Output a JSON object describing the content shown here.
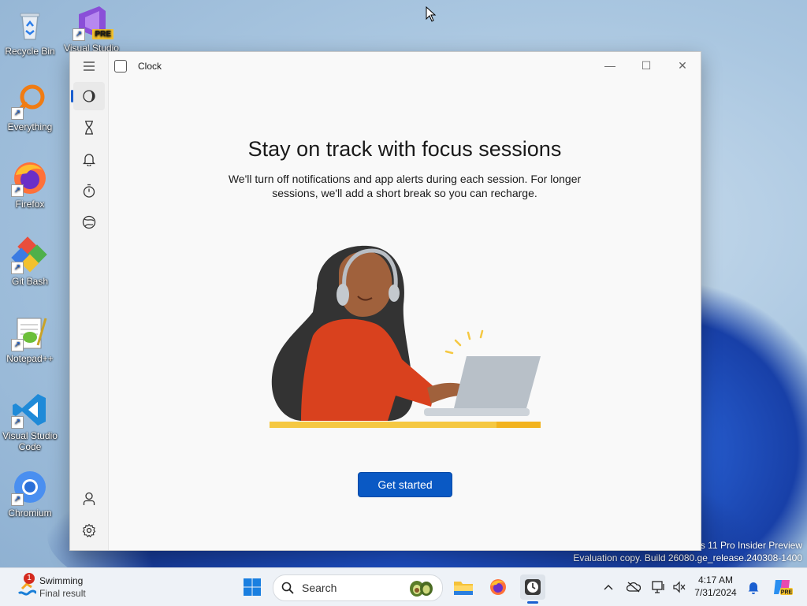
{
  "desktop": {
    "icons": [
      {
        "label": "Recycle Bin",
        "icon": "recycle-bin-icon"
      },
      {
        "label": "Visual Studio",
        "icon": "visual-studio-preview-icon",
        "badge": "PRE"
      },
      {
        "label": "Everything",
        "icon": "everything-search-icon"
      },
      {
        "label": "Firefox",
        "icon": "firefox-icon"
      },
      {
        "label": "Git Bash",
        "icon": "git-bash-icon"
      },
      {
        "label": "Notepad++",
        "icon": "notepad-plus-plus-icon"
      },
      {
        "label": "Visual Studio Code",
        "icon": "vscode-icon"
      },
      {
        "label": "Chromium",
        "icon": "chromium-icon"
      }
    ],
    "watermark": {
      "line1": "ws 11 Pro Insider Preview",
      "line2": "Evaluation copy. Build 26080.ge_release.240308-1400"
    }
  },
  "window": {
    "title": "Clock",
    "controls": {
      "minimize": "—",
      "maximize": "☐",
      "close": "✕"
    },
    "nav": [
      {
        "name": "menu",
        "icon": "hamburger-menu-icon"
      },
      {
        "name": "focus-sessions",
        "icon": "focus-sessions-icon",
        "selected": true
      },
      {
        "name": "timer",
        "icon": "hourglass-icon"
      },
      {
        "name": "alarm",
        "icon": "alarm-bell-icon"
      },
      {
        "name": "stopwatch",
        "icon": "stopwatch-icon"
      },
      {
        "name": "world-clock",
        "icon": "globe-icon"
      }
    ],
    "nav_bottom": [
      {
        "name": "account",
        "icon": "person-icon"
      },
      {
        "name": "settings",
        "icon": "gear-icon"
      }
    ],
    "heading": "Stay on track with focus sessions",
    "subtext": "We'll turn off notifications and app alerts during each session. For longer sessions, we'll add a short break so you can recharge.",
    "cta": "Get started"
  },
  "taskbar": {
    "widget": {
      "title": "Swimming",
      "subtitle": "Final result",
      "badge": "1"
    },
    "search_placeholder": "Search",
    "apps": [
      "start-icon",
      "file-explorer-icon",
      "firefox-icon",
      "clock-app-icon"
    ],
    "time": "4:17 AM",
    "date": "7/31/2024"
  },
  "colors": {
    "accent": "#0a59c4",
    "shirt": "#d9411e",
    "desk": "#f5c842",
    "laptop": "#b8c0c8"
  }
}
